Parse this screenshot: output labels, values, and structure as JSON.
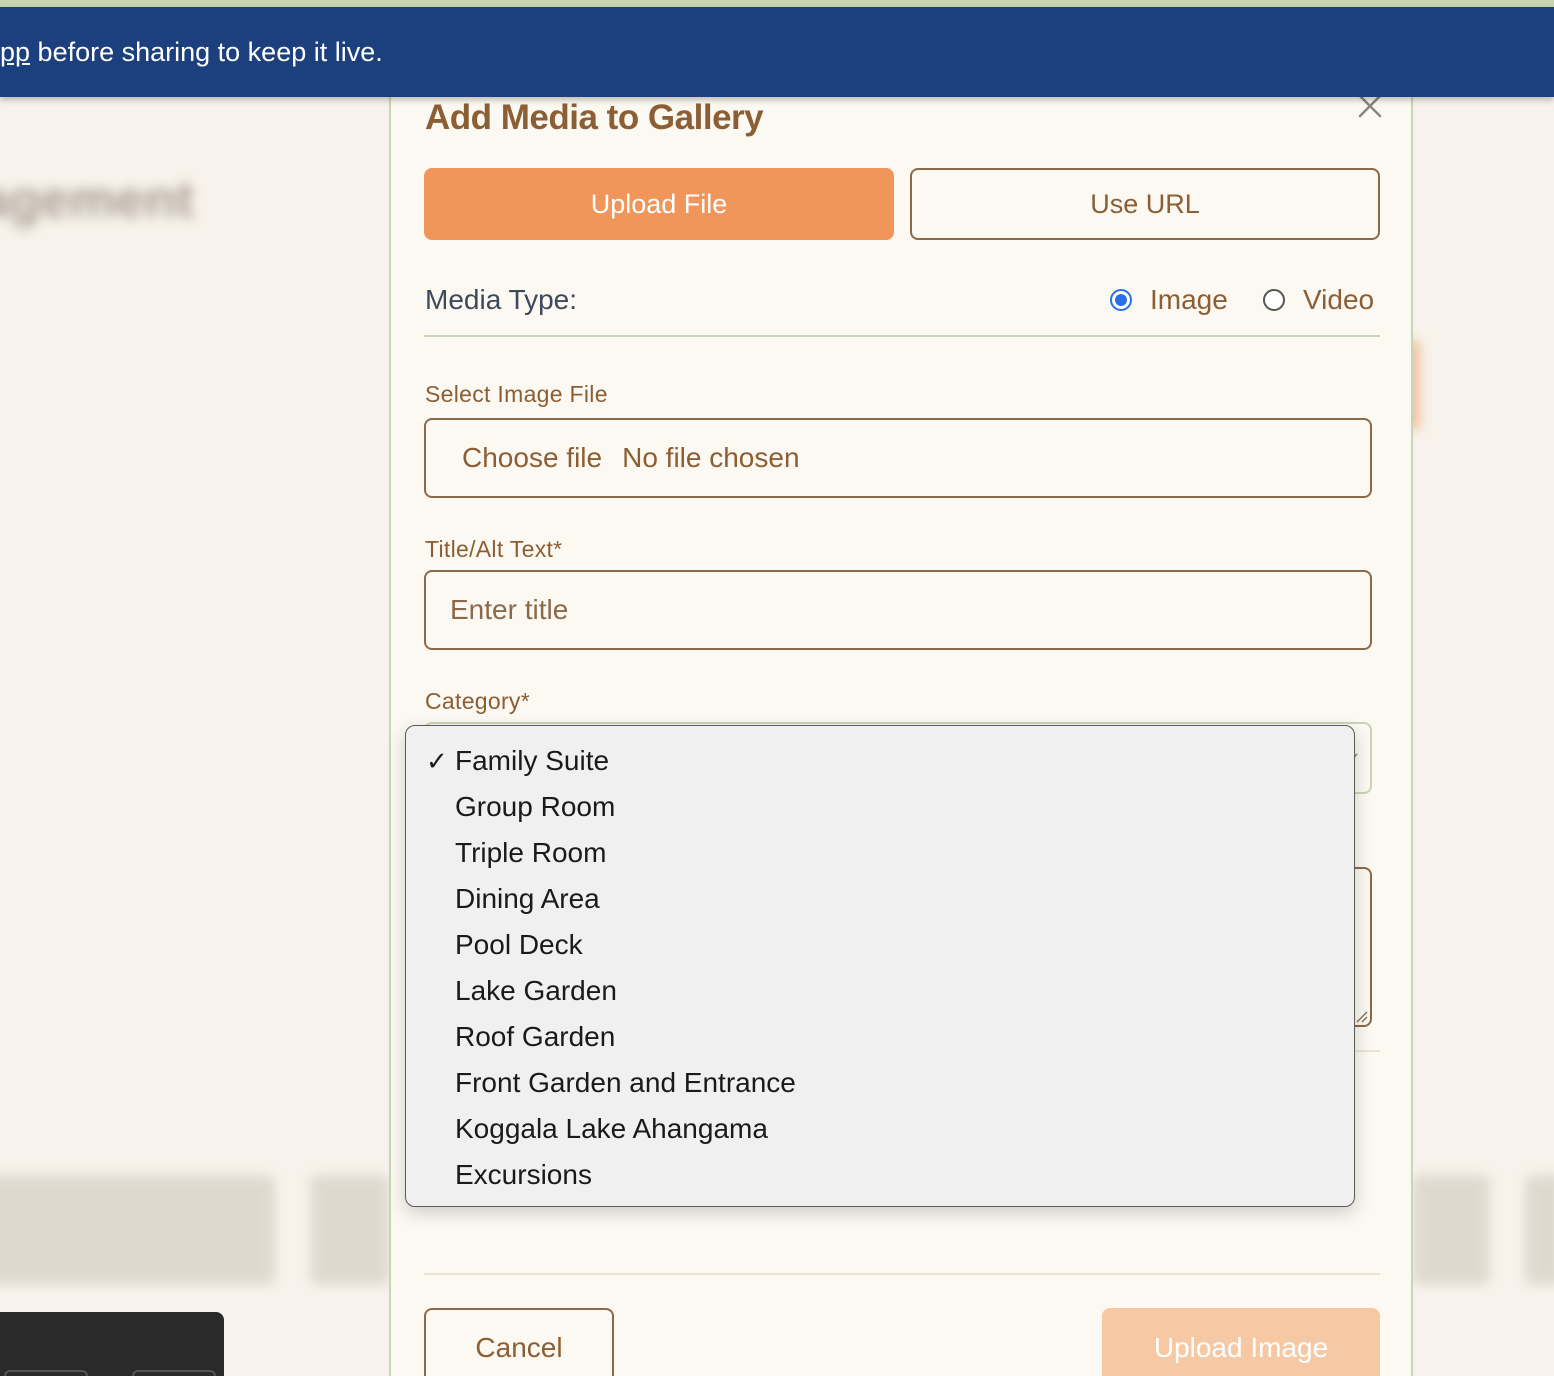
{
  "banner": {
    "link_text": "pp",
    "text": " before sharing to keep it live."
  },
  "modal": {
    "title": "Add Media to Gallery",
    "tabs": [
      {
        "label": "Upload File",
        "active": true
      },
      {
        "label": "Use URL",
        "active": false
      }
    ],
    "media_type": {
      "label": "Media Type:",
      "options": [
        {
          "label": "Image",
          "checked": true
        },
        {
          "label": "Video",
          "checked": false
        }
      ]
    },
    "file_field": {
      "label": "Select Image File",
      "button_text": "Choose file",
      "status_text": "No file chosen"
    },
    "title_field": {
      "label": "Title/Alt Text*",
      "placeholder": "Enter title",
      "value": ""
    },
    "category_field": {
      "label": "Category*",
      "selected": "Family Suite",
      "options": [
        "Family Suite",
        "Group Room",
        "Triple Room",
        "Dining Area",
        "Pool Deck",
        "Lake Garden",
        "Roof Garden",
        "Front Garden and Entrance",
        "Koggala Lake Ahangama",
        "Excursions"
      ]
    },
    "footer": {
      "cancel_label": "Cancel",
      "submit_label": "Upload Image"
    }
  },
  "colors": {
    "banner_bg": "#1b407d",
    "accent_orange": "#f0965a",
    "brand_brown": "#8b5e34",
    "radio_blue": "#2b6fe8",
    "disabled_submit": "#f6c8a3"
  },
  "icons": {
    "close": "close-icon",
    "check": "checkmark-icon",
    "chevron": "chevron-down-icon",
    "resize": "resize-handle-icon"
  }
}
